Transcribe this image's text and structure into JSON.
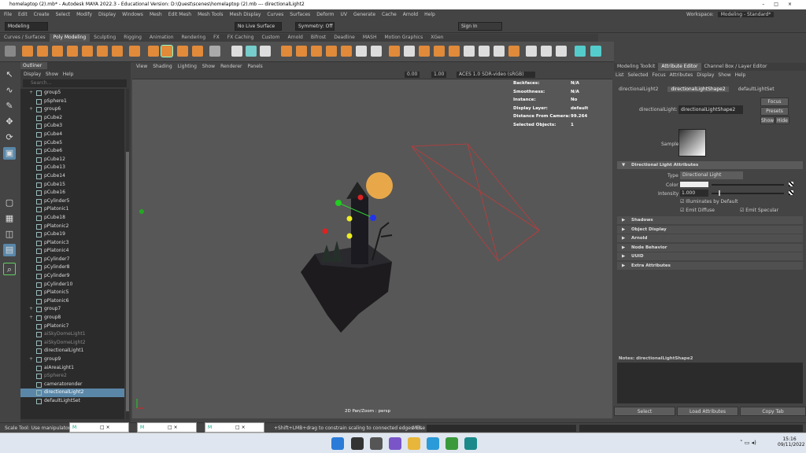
{
  "window": {
    "title": "homelaptop (2).mb* - Autodesk MAYA 2022.3 - Educational Version: D:\\Quest\\scenes\\homelaptop (2).mb  ---  directionalLight2",
    "controls": [
      "–",
      "□",
      "×"
    ]
  },
  "menu": [
    "File",
    "Edit",
    "Create",
    "Select",
    "Modify",
    "Display",
    "Windows",
    "Mesh",
    "Edit Mesh",
    "Mesh Tools",
    "Mesh Display",
    "Curves",
    "Surfaces",
    "Deform",
    "UV",
    "Generate",
    "Cache",
    "Arnold",
    "Help"
  ],
  "workspace": {
    "label": "Workspace:",
    "value": "Modeling - Standard*"
  },
  "status": {
    "mode": "Modeling",
    "live_surface": "No Live Surface",
    "symmetry": "Symmetry: Off",
    "sign_in": "Sign In"
  },
  "shelf_tabs": [
    "Curves / Surfaces",
    "Poly Modeling",
    "Sculpting",
    "Rigging",
    "Animation",
    "Rendering",
    "FX",
    "FX Caching",
    "Custom",
    "Arnold",
    "Bifrost",
    "Deadline",
    "MASH",
    "Motion Graphics",
    "XGen"
  ],
  "shelf_active": "Poly Modeling",
  "outliner": {
    "tab": "Outliner",
    "menu": [
      "Display",
      "Show",
      "Help"
    ],
    "search_placeholder": "Search...",
    "items": [
      {
        "label": "group5",
        "group": true
      },
      {
        "label": "pSphere1"
      },
      {
        "label": "group6",
        "group": true
      },
      {
        "label": "pCube2"
      },
      {
        "label": "pCube3"
      },
      {
        "label": "pCube4"
      },
      {
        "label": "pCube5"
      },
      {
        "label": "pCube6"
      },
      {
        "label": "pCube12"
      },
      {
        "label": "pCube13"
      },
      {
        "label": "pCube14"
      },
      {
        "label": "pCube15"
      },
      {
        "label": "pCube16"
      },
      {
        "label": "pCylinder5"
      },
      {
        "label": "pPlatonic1"
      },
      {
        "label": "pCube18"
      },
      {
        "label": "pPlatonic2"
      },
      {
        "label": "pCube19"
      },
      {
        "label": "pPlatonic3"
      },
      {
        "label": "pPlatonic4"
      },
      {
        "label": "pCylinder7"
      },
      {
        "label": "pCylinder8"
      },
      {
        "label": "pCylinder9"
      },
      {
        "label": "pCylinder10"
      },
      {
        "label": "pPlatonic5"
      },
      {
        "label": "pPlatonic6"
      },
      {
        "label": "group7",
        "group": true
      },
      {
        "label": "group8",
        "group": true
      },
      {
        "label": "pPlatonic7"
      },
      {
        "label": "aiSkyDomeLight1",
        "dim": true
      },
      {
        "label": "aiSkyDomeLight2",
        "dim": true
      },
      {
        "label": "directionalLight1"
      },
      {
        "label": "group9",
        "group": true
      },
      {
        "label": "aiAreaLight1"
      },
      {
        "label": "pSphere2",
        "dim": true
      },
      {
        "label": "cameratorender"
      },
      {
        "label": "directionalLight2",
        "selected": true
      },
      {
        "label": "defaultLightSet"
      }
    ]
  },
  "viewport": {
    "menu": [
      "View",
      "Shading",
      "Lighting",
      "Show",
      "Renderer",
      "Panels"
    ],
    "exposure": "0.00",
    "gamma": "1.00",
    "colorspace": "ACES 1.0 SDR-video (sRGB)",
    "camera": "2D Pan/Zoom : persp",
    "hud": [
      {
        "k": "Backfaces:",
        "v": "N/A"
      },
      {
        "k": "Smoothness:",
        "v": "N/A"
      },
      {
        "k": "Instance:",
        "v": "No"
      },
      {
        "k": "Display Layer:",
        "v": "default"
      },
      {
        "k": "Distance From Camera:",
        "v": "99.264"
      },
      {
        "k": "Selected Objects:",
        "v": "1"
      }
    ]
  },
  "ae": {
    "tabs": [
      "Modeling Toolkit",
      "Attribute Editor",
      "Channel Box / Layer Editor"
    ],
    "menu": [
      "List",
      "Selected",
      "Focus",
      "Attributes",
      "Display",
      "Show",
      "Help"
    ],
    "node_tabs": [
      "directionalLight2",
      "directionalLightShape2",
      "defaultLightSet"
    ],
    "node_label": "directionalLight:",
    "node_value": "directionalLightShape2",
    "focus": "Focus",
    "presets": "Presets",
    "show": "Show",
    "hide": "Hide",
    "sample": "Sample",
    "section": "Directional Light Attributes",
    "type_label": "Type",
    "type_value": "Directional Light",
    "color_label": "Color",
    "intensity_label": "Intensity",
    "intensity_value": "1.000",
    "illum": "Illuminates by Default",
    "diffuse": "Emit Diffuse",
    "specular": "Emit Specular",
    "collapsed": [
      "Shadows",
      "Object Display",
      "Arnold",
      "Node Behavior",
      "UUID",
      "Extra Attributes"
    ],
    "notes": "Notes: directionalLightShape2",
    "bottom": [
      "Select",
      "Load Attributes",
      "Copy Tab"
    ]
  },
  "help": {
    "text": "Scale Tool: Use manipulator",
    "hint": "+Shift+LMB+drag to constrain scaling to connected edges. Use D or INS",
    "mel": "MEL"
  },
  "taskbar": {
    "time": "15:16",
    "date": "09/11/2022"
  },
  "colors": {
    "accent": "#5a87a8",
    "light_line": "#c23a3a",
    "moon": "#e8a84a"
  }
}
